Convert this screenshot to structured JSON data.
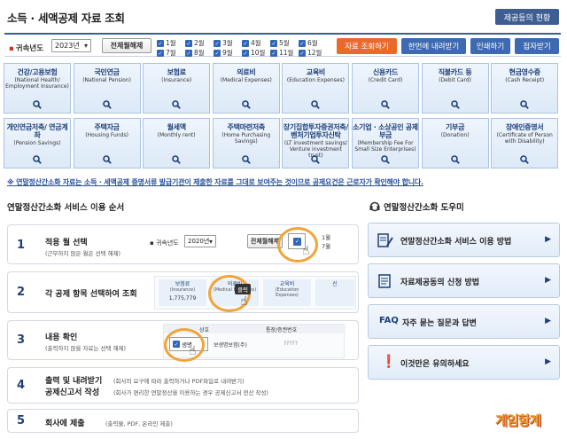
{
  "header": {
    "title": "소득 · 세액공제 자료 조회",
    "status_button": "제공등의 현황"
  },
  "filter": {
    "year_label": "귀속년도",
    "year_value": "2023년",
    "select_all": "전체월해제",
    "months": [
      "1월",
      "2월",
      "3월",
      "4월",
      "5월",
      "6월",
      "7월",
      "8월",
      "9월",
      "10월",
      "11월",
      "12월"
    ],
    "search_button": "자료 조회하기",
    "download_button": "한번에 내려받기",
    "print_button": "인쇄하기",
    "help_button": "접자받기"
  },
  "categories": [
    {
      "ko": "건강/고용보험",
      "en": "(National Health/ Employment Insurance)"
    },
    {
      "ko": "국민연금",
      "en": "(National Pension)"
    },
    {
      "ko": "보험료",
      "en": "(Insurance)"
    },
    {
      "ko": "의료비",
      "en": "(Medical Expenses)"
    },
    {
      "ko": "교육비",
      "en": "(Education Expenses)"
    },
    {
      "ko": "신용카드",
      "en": "(Credit Card)"
    },
    {
      "ko": "직불카드 등",
      "en": "(Debit Card)"
    },
    {
      "ko": "현금영수증",
      "en": "(Cash Receipt)"
    },
    {
      "ko": "개인연금저축/ 연금계좌",
      "en": "(Pension Savings)"
    },
    {
      "ko": "주택자금",
      "en": "(Housing Funds)"
    },
    {
      "ko": "월세액",
      "en": "(Monthly rent)"
    },
    {
      "ko": "주택마련저축",
      "en": "(Home Purchasing Savings)"
    },
    {
      "ko": "장기집합투자증권저축/ 벤처기업투자신탁",
      "en": "(LT investment savings/ Venture investment trust)"
    },
    {
      "ko": "소기업 · 소상공인 공제부금",
      "en": "(Membership Fee For Small Size Enterprises)"
    },
    {
      "ko": "기부금",
      "en": "(Donation)"
    },
    {
      "ko": "장애인증명서",
      "en": "(Certificate of Person with Disability)"
    }
  ],
  "notice": "※ 연말정산간소화 자료는 소득 · 세액공제 증명서류 발급기관이 제출한 자료를 그대로 보여주는 것이므로 공제요건은 근로자가 확인해야 합니다.",
  "usage": {
    "title": "연말정산간소화 서비스 이용 순서",
    "steps": [
      {
        "num": "1",
        "title": "적용 월 선택",
        "sub": "(근무하지 않은 월은 선택 해제)"
      },
      {
        "num": "2",
        "title": "각 공제 항목 선택하여 조회",
        "sub": ""
      },
      {
        "num": "3",
        "title": "내용 확인",
        "sub": "(출력하지 않을 자료는 선택 해제)"
      },
      {
        "num": "4",
        "title": "출력 및 내려받기",
        "title2": "공제신고서 작성",
        "sub": "(회사의 요구에 따라 출력하거나 PDF파일로 내려받기)",
        "sub2": "(회사가 편리한 연말정산을 이용하는 경우 공제신고서 전산 작성)"
      },
      {
        "num": "5",
        "title": "회사에 제출",
        "sub": "(출력물, PDF, 온라인 제출)"
      }
    ],
    "thumb1": {
      "year_label": "귀속년도",
      "year": "2020년",
      "button": "전체월해제",
      "m1": "1월",
      "m2": "7월"
    },
    "thumb2": {
      "c1": "보험료",
      "c1e": "(Insurance)",
      "c2": "의료비",
      "c2e": "(Medical Expenses)",
      "c3": "교육비",
      "c3e": "(Education Expenses)",
      "c4": "신",
      "value": "1,775,779",
      "click": "클릭"
    },
    "thumb3": {
      "h1": "상호",
      "h2": "통장/증권번호",
      "r1": "생명",
      "r1b": "보생명보험(주)",
      "r1c": "?????"
    }
  },
  "help": {
    "title": "연말정산간소화 도우미",
    "items": [
      {
        "label": "연말정산간소화 서비스 이용 방법",
        "icon": "document-pen-icon"
      },
      {
        "label": "자료제공동의 신청 방법",
        "icon": "document-icon"
      },
      {
        "label": "자주 묻는 질문과 답변",
        "prefix": "FAQ",
        "icon": "faq-icon"
      },
      {
        "label": "이것만은 유의하세요",
        "icon": "exclamation-icon"
      }
    ],
    "arrow": "▶"
  },
  "logo": "게임항계"
}
